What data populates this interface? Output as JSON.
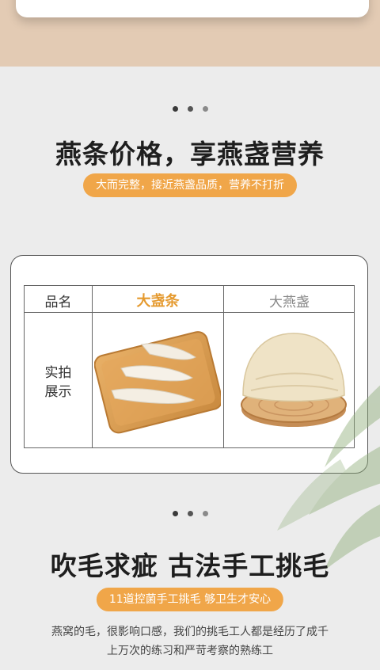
{
  "section1": {
    "title": "燕条价格，享燕盏营养",
    "subtitle": "大而完整，接近燕盏品质，营养不打折"
  },
  "table": {
    "header_col1": "品名",
    "header_col2": "大盏条",
    "header_col3": "大燕盏",
    "row_label_line1": "实拍",
    "row_label_line2": "展示"
  },
  "section2": {
    "title": "吹毛求疵 古法手工挑毛",
    "subtitle": "11道控菌手工挑毛 够卫生才安心",
    "description_line1": "燕窝的毛，很影响口感，我们的挑毛工人都是经历了成千",
    "description_line2": "上万次的练习和严苛考察的熟练工"
  },
  "colors": {
    "accent": "#f0a649",
    "highlight_text": "#e59a2f",
    "top_band": "#e3cbb4",
    "background": "#ececec"
  }
}
